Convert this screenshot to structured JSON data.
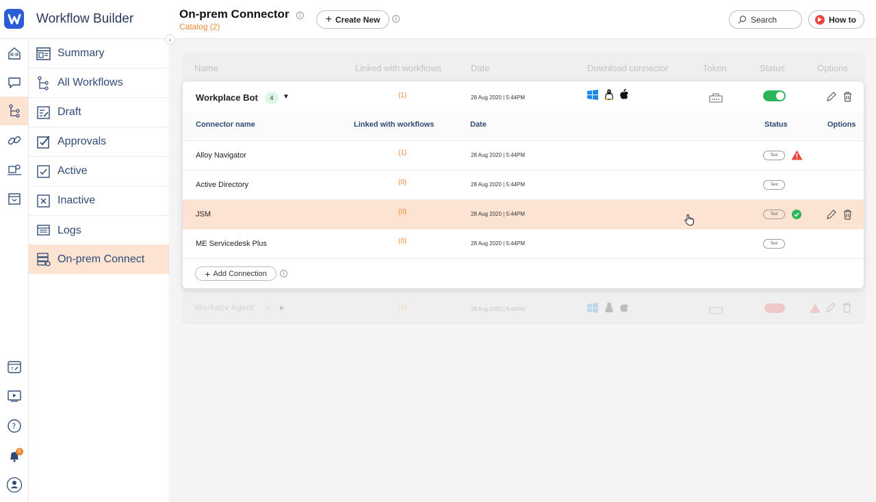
{
  "app": {
    "brand": "Workflow Builder"
  },
  "header": {
    "title": "On-prem Connector",
    "catalog": "Catalog (2)",
    "create_label": "Create New",
    "search_label": "Search",
    "howto_label": "How to"
  },
  "nav": {
    "items": [
      {
        "label": "Summary",
        "icon": "summary-icon"
      },
      {
        "label": "All Workflows",
        "icon": "workflows-icon"
      },
      {
        "label": "Draft",
        "icon": "draft-icon"
      },
      {
        "label": "Approvals",
        "icon": "approvals-icon"
      },
      {
        "label": "Active",
        "icon": "check-box-icon"
      },
      {
        "label": "Inactive",
        "icon": "x-box-icon"
      },
      {
        "label": "Logs",
        "icon": "logs-icon"
      },
      {
        "label": "On-prem Connect",
        "icon": "server-icon",
        "active": true
      }
    ]
  },
  "rail": {
    "notification_count": "5"
  },
  "table": {
    "headers": [
      "Name",
      "Linked with workflows",
      "Date",
      "Download connector",
      "Token",
      "Status",
      "Options"
    ],
    "bot": {
      "name": "Workplace Bot",
      "count": "4",
      "linked": "(1)",
      "date": "28 Aug 2020 | 5:44PM",
      "status_on": true
    },
    "sub_headers": [
      "Connector name",
      "Linked with workflows",
      "Date",
      "Status",
      "Options"
    ],
    "connectors": [
      {
        "name": "Alloy Navigator",
        "linked": "(1)",
        "date": "28 Aug 2020 | 5:44PM",
        "test": "Test",
        "state": "warning"
      },
      {
        "name": "Active Directory",
        "linked": "(0)",
        "date": "28 Aug 2020 | 5:44PM",
        "test": "Test",
        "state": ""
      },
      {
        "name": "JSM",
        "linked": "(0)",
        "date": "28 Aug 2020 | 5:44PM",
        "test": "Test",
        "state": "success",
        "highlighted": true
      },
      {
        "name": "ME Servicedesk Plus",
        "linked": "(0)",
        "date": "28 Aug 2020 | 5:44PM",
        "test": "Test",
        "state": ""
      }
    ],
    "add_connection": "Add Connection",
    "agent": {
      "name": "Workativ Agent",
      "count": "0",
      "linked": "(1)",
      "date": "28 Aug 2020 | 5:44PM"
    }
  },
  "colors": {
    "accent": "#f0862f",
    "nav_text": "#2f4a74",
    "highlight": "#fde3d2",
    "toggle_on": "#2db55d",
    "warning": "#e8453c"
  }
}
